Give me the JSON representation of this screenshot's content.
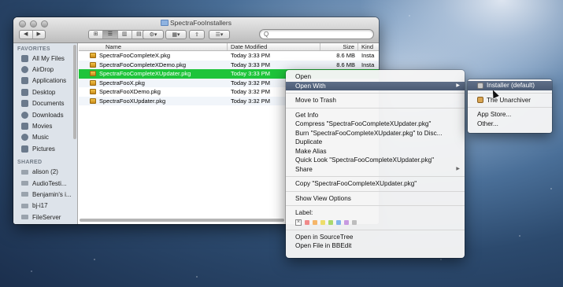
{
  "window": {
    "title": "SpectraFooInstallers",
    "nav": {
      "back": "◀",
      "forward": "▶"
    },
    "view_buttons": [
      "⊞",
      "☰",
      "▥",
      "▤"
    ],
    "action": "⚙▾",
    "arrange": "▦▾",
    "share": "⇪",
    "tag": "☰▾",
    "search_placeholder": "Q"
  },
  "sidebar": {
    "favorites_heading": "FAVORITES",
    "favorites": [
      {
        "label": "All My Files",
        "icon": "all-files-icon"
      },
      {
        "label": "AirDrop",
        "icon": "airdrop-icon"
      },
      {
        "label": "Applications",
        "icon": "applications-icon"
      },
      {
        "label": "Desktop",
        "icon": "desktop-icon"
      },
      {
        "label": "Documents",
        "icon": "documents-icon"
      },
      {
        "label": "Downloads",
        "icon": "downloads-icon"
      },
      {
        "label": "Movies",
        "icon": "movies-icon"
      },
      {
        "label": "Music",
        "icon": "music-icon"
      },
      {
        "label": "Pictures",
        "icon": "pictures-icon"
      }
    ],
    "shared_heading": "SHARED",
    "shared": [
      {
        "label": "alison (2)"
      },
      {
        "label": "AudioTesti..."
      },
      {
        "label": "Benjamin's i..."
      },
      {
        "label": "bj-i17"
      },
      {
        "label": "FileServer"
      }
    ]
  },
  "columns": {
    "name": "Name",
    "date": "Date Modified",
    "size": "Size",
    "kind": "Kind"
  },
  "files": [
    {
      "name": "SpectraFooCompleteX.pkg",
      "date": "Today 3:33 PM",
      "size": "8.6 MB",
      "kind": "Insta"
    },
    {
      "name": "SpectraFooCompleteXDemo.pkg",
      "date": "Today 3:33 PM",
      "size": "8.6 MB",
      "kind": "Insta"
    },
    {
      "name": "SpectraFooCompleteXUpdater.pkg",
      "date": "Today 3:33 PM",
      "size": "",
      "kind": ""
    },
    {
      "name": "SpectraFooX.pkg",
      "date": "Today 3:32 PM",
      "size": "",
      "kind": ""
    },
    {
      "name": "SpectraFooXDemo.pkg",
      "date": "Today 3:32 PM",
      "size": "",
      "kind": ""
    },
    {
      "name": "SpectraFooXUpdater.pkg",
      "date": "Today 3:32 PM",
      "size": "",
      "kind": ""
    }
  ],
  "context_menu": {
    "open": "Open",
    "open_with": "Open With",
    "move_to_trash": "Move to Trash",
    "get_info": "Get Info",
    "compress": "Compress \"SpectraFooCompleteXUpdater.pkg\"",
    "burn": "Burn \"SpectraFooCompleteXUpdater.pkg\" to Disc...",
    "duplicate": "Duplicate",
    "make_alias": "Make Alias",
    "quick_look": "Quick Look \"SpectraFooCompleteXUpdater.pkg\"",
    "share": "Share",
    "copy": "Copy \"SpectraFooCompleteXUpdater.pkg\"",
    "show_view_options": "Show View Options",
    "label": "Label:",
    "label_none": "×",
    "label_colors": [
      "#f08a8a",
      "#f5b66a",
      "#eedd6a",
      "#a9d86e",
      "#82b4ec",
      "#c79ae0",
      "#bdbdbd"
    ],
    "open_in_sourcetree": "Open in SourceTree",
    "open_in_bbedit": "Open File in BBEdit"
  },
  "submenu": {
    "installer": "Installer (default)",
    "unarchiver": "The Unarchiver",
    "app_store": "App Store...",
    "other": "Other..."
  }
}
